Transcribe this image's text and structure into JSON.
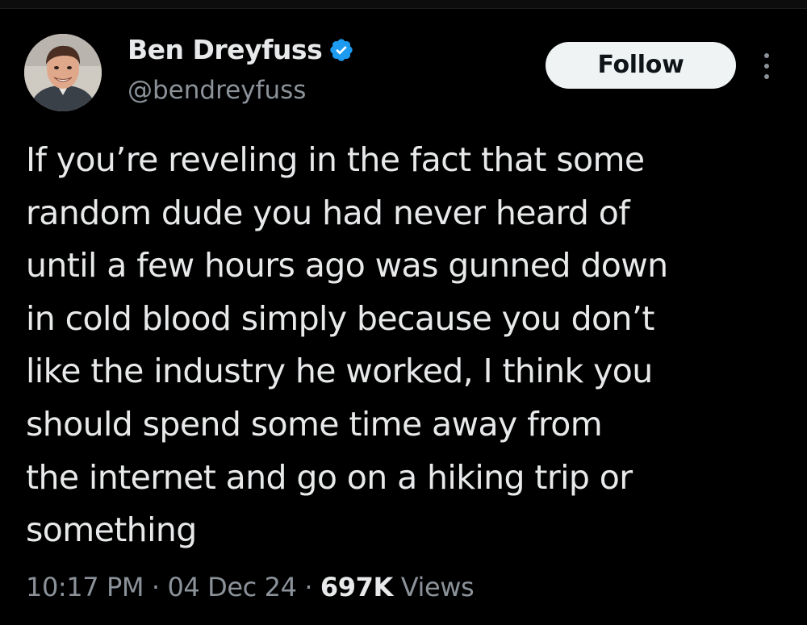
{
  "tweet": {
    "author": {
      "display_name": "Ben Dreyfuss",
      "handle": "@bendreyfuss",
      "verified": true,
      "verified_icon": "verified-badge-icon"
    },
    "actions": {
      "follow_label": "Follow",
      "more_icon": "more-vertical-icon"
    },
    "text_lines": [
      "If you’re reveling in the fact that some",
      "random dude you had never heard of",
      "until a few hours ago was gunned down",
      "in cold blood simply because you don’t",
      "like the industry he worked, I think you",
      "should spend some time away from",
      "the internet and go on a hiking trip or",
      "something"
    ],
    "time": "10:17 PM",
    "date": "04 Dec 24",
    "separator": "·",
    "views_count": "697K",
    "views_label": "Views"
  },
  "colors": {
    "background": "#000000",
    "primary_text": "#e7e9ea",
    "secondary_text": "#8b9299",
    "verified_blue": "#1d9bf0",
    "follow_button_bg": "#eff3f4"
  }
}
